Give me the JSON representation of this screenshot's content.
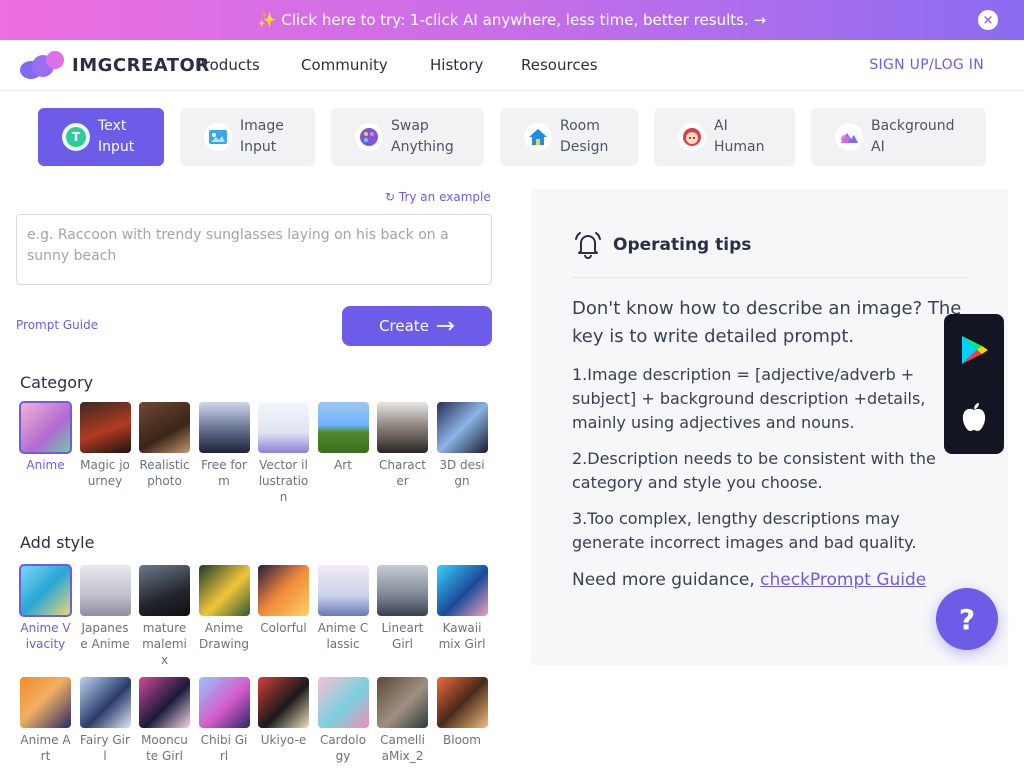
{
  "banner": {
    "text": "✨ Click here to try: 1-click AI anywhere, less time, better results. →",
    "close_icon": "×"
  },
  "nav": {
    "logo_text": "IMGCREATOR",
    "items": [
      "Products",
      "Community",
      "History",
      "Resources"
    ],
    "signup": "SIGN UP/LOG IN"
  },
  "tabs": [
    {
      "label": "Text\nInput",
      "icon": "text-input-icon",
      "active": true
    },
    {
      "label": "Image\nInput",
      "icon": "image-input-icon",
      "active": false
    },
    {
      "label": "Swap\nAnything",
      "icon": "swap-anything-icon",
      "active": false
    },
    {
      "label": "Room\nDesign",
      "icon": "room-design-icon",
      "active": false
    },
    {
      "label": "AI\nHuman",
      "icon": "ai-human-icon",
      "active": false
    },
    {
      "label": "Background\nAI",
      "icon": "background-ai-icon",
      "active": false
    }
  ],
  "prompt": {
    "try_example": "Try an example",
    "placeholder": "e.g. Raccoon with trendy sunglasses laying on his back on a sunny beach",
    "guide": "Prompt Guide",
    "create": "Create"
  },
  "category": {
    "title": "Category",
    "items": [
      "Anime",
      "Magic journey",
      "Realistic photo",
      "Free form",
      "Vector illustration",
      "Art",
      "Character",
      "3D design"
    ],
    "selected": 0
  },
  "style": {
    "title": "Add style",
    "items": [
      "Anime Vivacity",
      "Japanese Anime",
      "mature malemix",
      "Anime Drawing",
      "Colorful",
      "Anime Classic",
      "Lineart Girl",
      "Kawaii mix Girl",
      "Anime Art",
      "Fairy Girl",
      "Mooncute Girl",
      "Chibi Girl",
      "Ukiyo-e",
      "Cardology",
      "CamelliaMix_2",
      "Bloom"
    ],
    "selected": 0
  },
  "tips": {
    "title": "Operating tips",
    "lead": "Don't know how to describe an image? The key is to write detailed prompt.",
    "tip1": "1.Image description = [adjective/adverb + subject] + background description +details, mainly using adjectives and nouns.",
    "tip2": "2.Description needs to be consistent with the category and style you choose.",
    "tip3": "3.Too complex, lengthy descriptions may generate incorrect images and bad quality.",
    "more_prefix": "Need more guidance, ",
    "more_link": "checkPrompt Guide"
  },
  "help_label": "?"
}
